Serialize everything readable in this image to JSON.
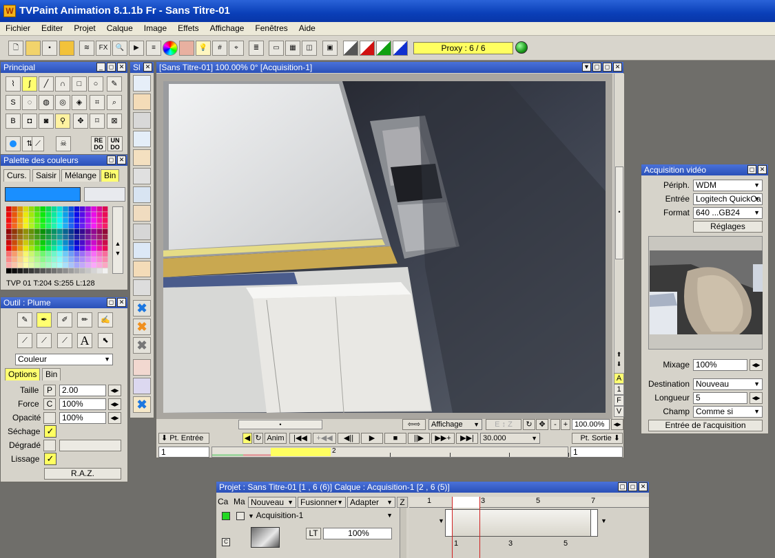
{
  "app": {
    "title": "TVPaint Animation 8.1.1b Fr - Sans Titre-01"
  },
  "menu": [
    "Fichier",
    "Editer",
    "Projet",
    "Calque",
    "Image",
    "Effets",
    "Affichage",
    "Fenêtres",
    "Aide"
  ],
  "toolbar": {
    "fx_label": "FX",
    "proxy": "Proxy : 6 / 6"
  },
  "principal": {
    "title": "Principal",
    "redo_label": "RE DO",
    "undo_label": "UN DO"
  },
  "palette": {
    "title": "Palette des couleurs",
    "tabs": [
      "Curs.",
      "Saisir",
      "Mélange",
      "Bin"
    ],
    "active_tab": "Bin",
    "current_color": "#1a8fff",
    "info": "TVP 01 T:204 S:255 L:128"
  },
  "outil": {
    "title": "Outil : Plume",
    "mode": "Couleur",
    "tabs": [
      "Options",
      "Bin"
    ],
    "taille_label": "Taille",
    "taille_mode": "P",
    "taille_value": "2.00",
    "force_label": "Force",
    "force_mode": "C",
    "force_value": "100%",
    "opacite_label": "Opacité",
    "opacite_value": "100%",
    "sechage_label": "Séchage",
    "degrade_label": "Dégradé",
    "lissage_label": "Lissage",
    "raz_label": "R.A.Z."
  },
  "strip": {
    "title": "Sl"
  },
  "canvas": {
    "title": "[Sans Titre-01]  100.00%  0°  [Acquisition-1]",
    "affichage": "Affichage",
    "zoom": "100.00%",
    "pt_entree": "Pt. Entrée",
    "anim": "Anim",
    "fps": "30.000",
    "pt_sortie": "Pt. Sortie",
    "frame_start": "1",
    "frame_end": "1",
    "ruler_mark": "2",
    "side_letters": [
      "A",
      "1",
      "F",
      "V"
    ]
  },
  "acquisition": {
    "title": "Acquisition vidéo",
    "periph_label": "Périph.",
    "periph_value": "WDM",
    "entree_label": "Entrée",
    "entree_value": "Logitech QuickCa",
    "format_label": "Format",
    "format_value": "640 ...GB24",
    "reglages": "Réglages",
    "mixage_label": "Mixage",
    "mixage_value": "100%",
    "destination_label": "Destination",
    "destination_value": "Nouveau",
    "longueur_label": "Longueur",
    "longueur_value": "5",
    "champ_label": "Champ",
    "champ_value": "Comme si",
    "start_button": "Entrée de l'acquisition"
  },
  "timeline": {
    "title": "Projet : Sans Titre-01 [1 , 6  (6)]       Calque : Acquisition-1 [2 , 6  (5)]",
    "col_ca": "Ca",
    "col_ma": "Ma",
    "nouveau": "Nouveau",
    "fusionner": "Fusionner",
    "adapter": "Adapter",
    "z": "Z",
    "layer_name": "Acquisition-1",
    "lt": "LT",
    "opacity": "100%",
    "top_ticks": [
      "1",
      "3",
      "5",
      "7"
    ],
    "bottom_ticks": [
      "1",
      "3",
      "5"
    ]
  }
}
